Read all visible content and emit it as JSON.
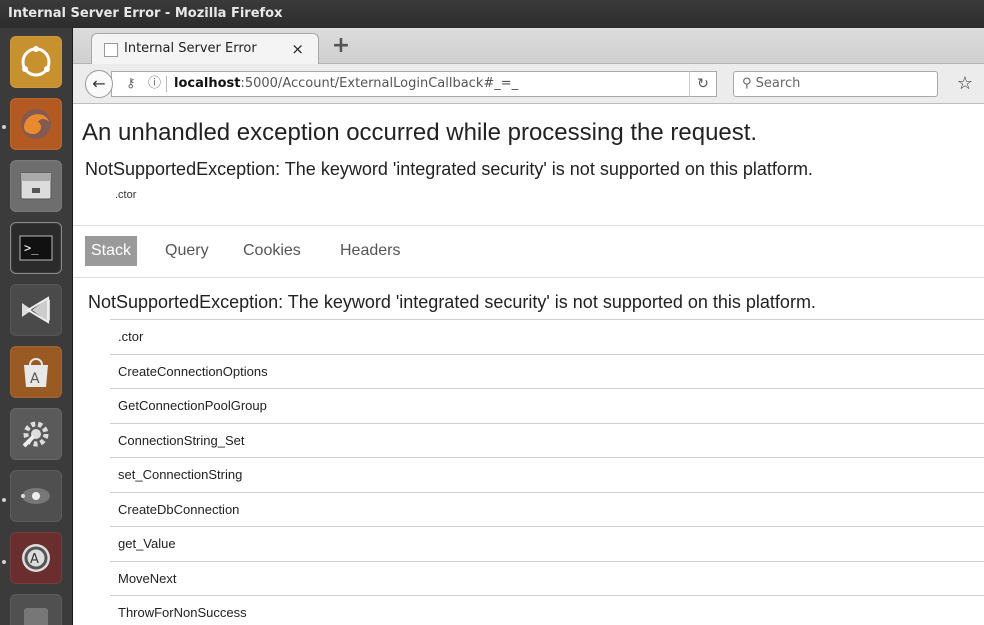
{
  "window": {
    "title": "Internal Server Error - Mozilla Firefox"
  },
  "launcher": {
    "items": [
      {
        "name": "ubuntu-dash-icon",
        "color": "#d9a441"
      },
      {
        "name": "firefox-icon",
        "color": "#c8681f"
      },
      {
        "name": "files-icon",
        "color": "#8a8a8a"
      },
      {
        "name": "terminal-icon",
        "color": "#2a2a2a"
      },
      {
        "name": "visual-studio-code-icon",
        "color": "#3f3f3f"
      },
      {
        "name": "software-center-icon",
        "color": "#b06a2a"
      },
      {
        "name": "system-settings-icon",
        "color": "#6a6a6a"
      },
      {
        "name": "remote-desktop-icon",
        "color": "#5a5a5a"
      },
      {
        "name": "software-updater-icon",
        "color": "#7a3a3a"
      },
      {
        "name": "launcher-item-icon",
        "color": "#5a5a5a"
      }
    ]
  },
  "browser": {
    "tab_title": "Internal Server Error",
    "tab_close": "×",
    "new_tab": "+",
    "back": "←",
    "url_host": "localhost",
    "url_rest": ":5000/Account/ExternalLoginCallback#_=_",
    "reload": "↻",
    "search_placeholder": "Search",
    "search_glyph": "⚲",
    "star": "☆"
  },
  "page": {
    "heading": "An unhandled exception occurred while processing the request.",
    "error_title": "NotSupportedException: The keyword 'integrated security' is not supported on this platform.",
    "error_location": ".ctor",
    "tabs": [
      {
        "label": "Stack",
        "active": true
      },
      {
        "label": "Query",
        "active": false
      },
      {
        "label": "Cookies",
        "active": false
      },
      {
        "label": "Headers",
        "active": false
      }
    ],
    "stack_title": "NotSupportedException: The keyword 'integrated security' is not supported on this platform.",
    "frames": [
      ".ctor",
      "CreateConnectionOptions",
      "GetConnectionPoolGroup",
      "ConnectionString_Set",
      "set_ConnectionString",
      "CreateDbConnection",
      "get_Value",
      "MoveNext",
      "ThrowForNonSuccess"
    ]
  }
}
